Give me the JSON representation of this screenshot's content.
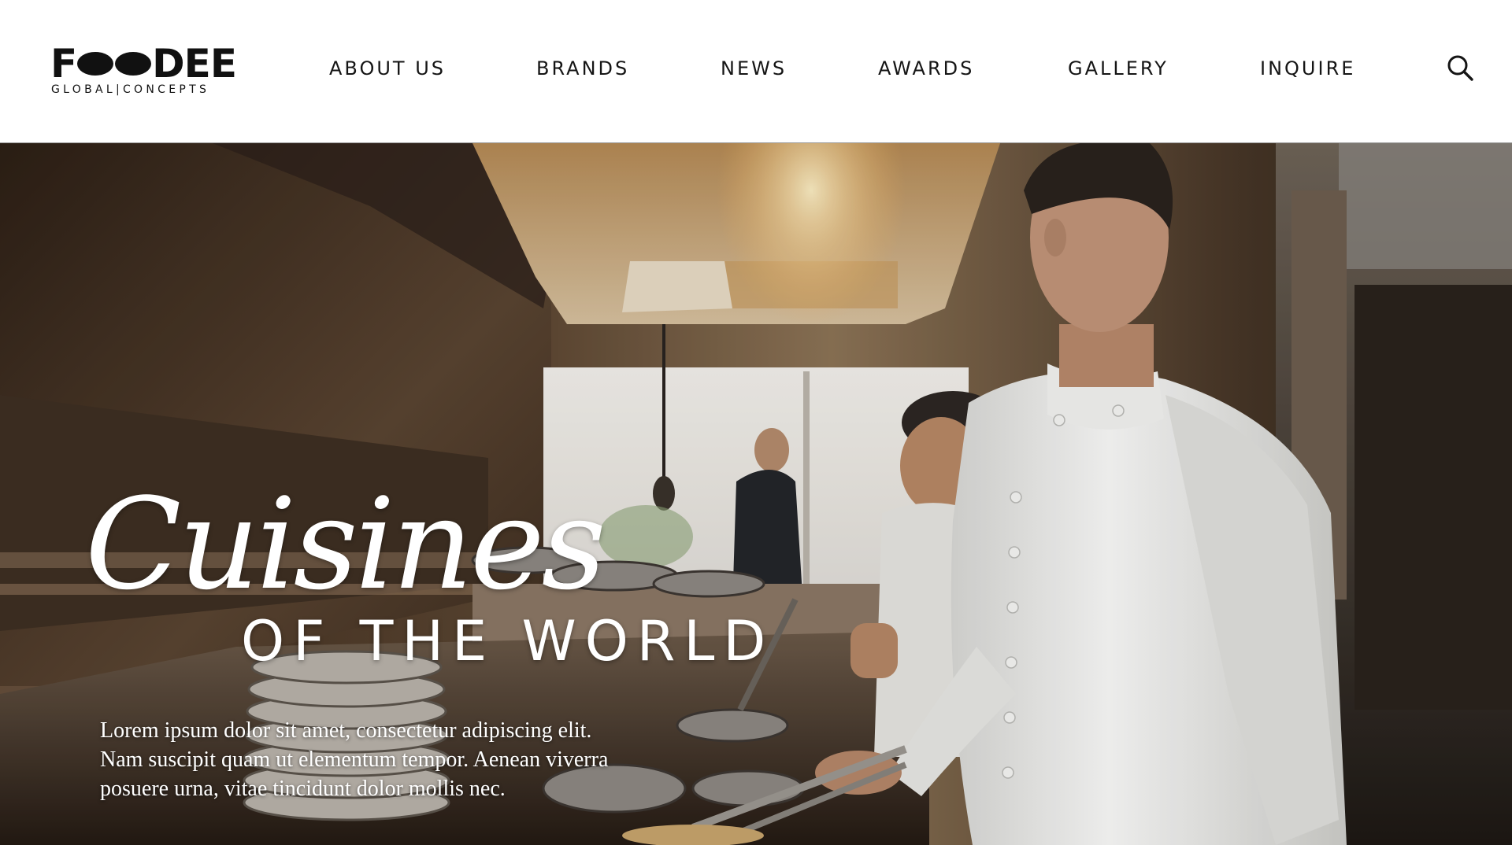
{
  "logo": {
    "word": "FOODEE",
    "tagline": "GLOBAL|CONCEPTS"
  },
  "nav": {
    "items": [
      {
        "label": "ABOUT US"
      },
      {
        "label": "BRANDS"
      },
      {
        "label": "NEWS"
      },
      {
        "label": "AWARDS"
      },
      {
        "label": "GALLERY"
      },
      {
        "label": "INQUIRE"
      }
    ],
    "search_icon": "search-icon"
  },
  "hero": {
    "script_title": "Cuisines",
    "subtitle": "OF THE WORLD",
    "body_lines": [
      "Lorem ipsum dolor sit amet, consectetur adipiscing elit.",
      "Nam suscipit quam ut elementum tempor. Aenean viverra",
      "posuere urna, vitae tincidunt dolor mollis nec."
    ],
    "image": "kitchen-chef-photo"
  },
  "colors": {
    "text": "#151515",
    "hero_text": "#ffffff",
    "divider": "#9a9a9a"
  }
}
